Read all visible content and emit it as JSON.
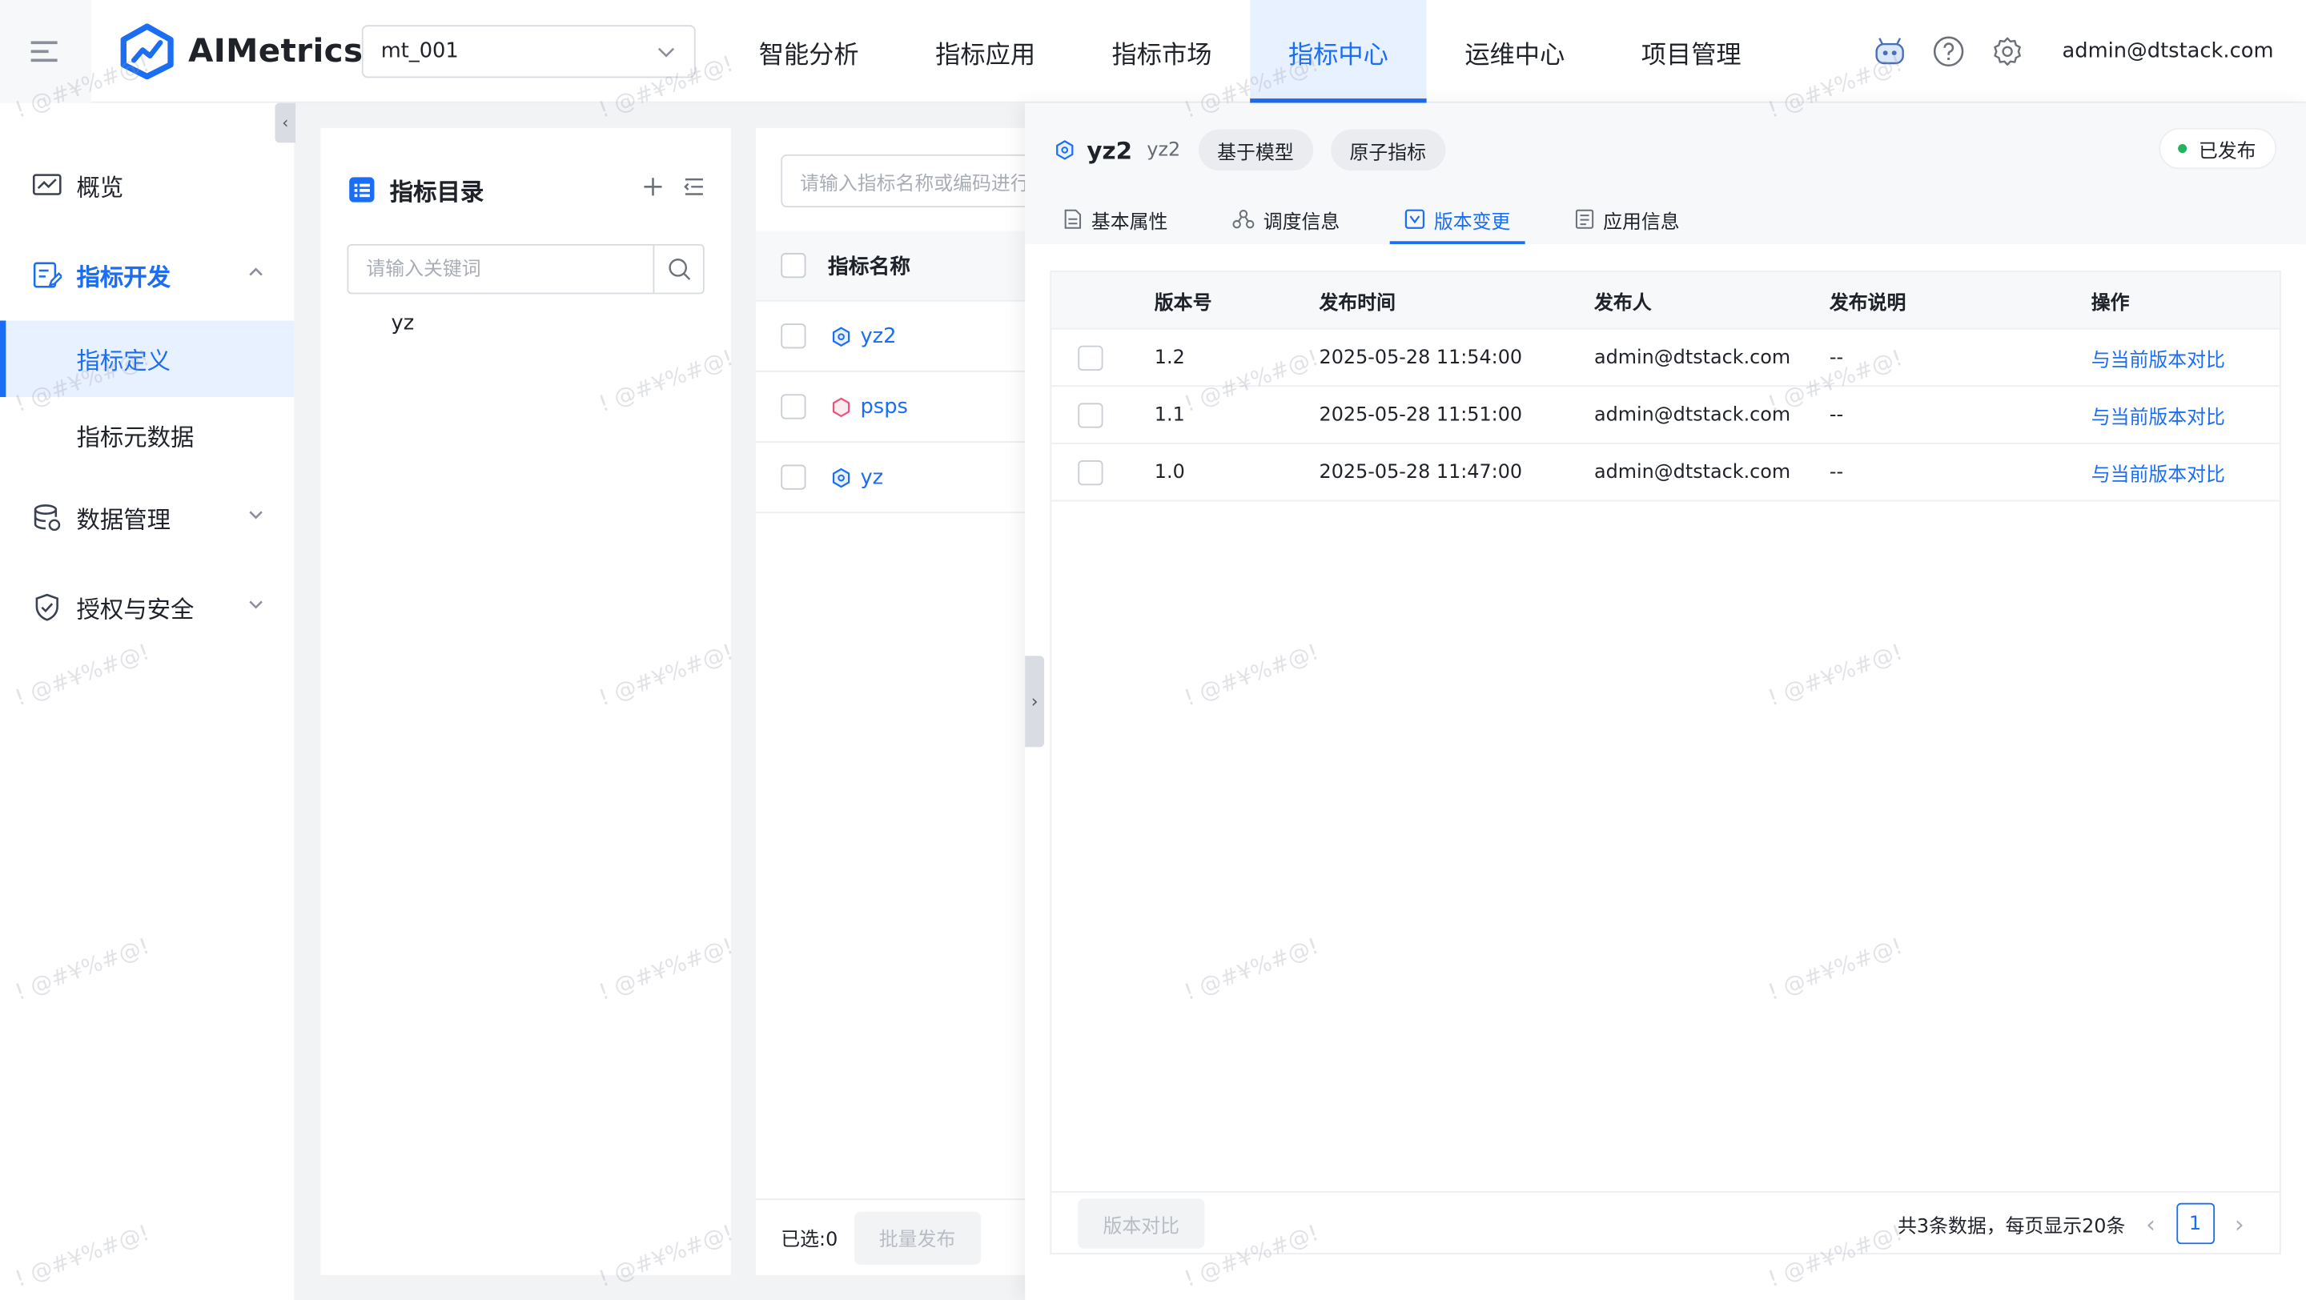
{
  "app": {
    "logo_text": "AIMetrics",
    "brand_color": "#1b6ef3"
  },
  "project_select": {
    "value": "mt_001"
  },
  "nav": {
    "items": [
      {
        "label": "智能分析",
        "active": false
      },
      {
        "label": "指标应用",
        "active": false
      },
      {
        "label": "指标市场",
        "active": false
      },
      {
        "label": "指标中心",
        "active": true
      },
      {
        "label": "运维中心",
        "active": false
      },
      {
        "label": "项目管理",
        "active": false
      }
    ]
  },
  "top_right": {
    "user": "admin@dtstack.com",
    "icons": [
      "robot-icon",
      "help-icon",
      "settings-icon"
    ]
  },
  "sidebar": {
    "items": [
      {
        "label": "概览",
        "icon": "overview-icon"
      },
      {
        "label": "指标开发",
        "icon": "metric-dev-icon",
        "expanded": true
      },
      {
        "label": "数据管理",
        "icon": "database-icon"
      },
      {
        "label": "授权与安全",
        "icon": "shield-icon"
      }
    ],
    "sub_items": [
      {
        "label": "指标定义",
        "active": true
      },
      {
        "label": "指标元数据",
        "active": false
      }
    ]
  },
  "directory": {
    "title": "指标目录",
    "search_placeholder": "请输入关键词",
    "tree": [
      "yz"
    ]
  },
  "metric_list": {
    "search_placeholder": "请输入指标名称或编码进行",
    "column_header": "指标名称",
    "rows": [
      {
        "name": "yz2",
        "icon": "model-metric-icon"
      },
      {
        "name": "psps",
        "icon": "atomic-metric-icon"
      },
      {
        "name": "yz",
        "icon": "model-metric-icon"
      }
    ],
    "selected_label": "已选:0",
    "batch_publish_label": "批量发布"
  },
  "drawer": {
    "name": "yz2",
    "code": "yz2",
    "tags": [
      "基于模型",
      "原子指标"
    ],
    "status": "已发布",
    "tabs": [
      {
        "label": "基本属性",
        "icon": "document-icon",
        "active": false
      },
      {
        "label": "调度信息",
        "icon": "schedule-icon",
        "active": false
      },
      {
        "label": "版本变更",
        "icon": "version-icon",
        "active": true
      },
      {
        "label": "应用信息",
        "icon": "app-info-icon",
        "active": false
      }
    ],
    "table": {
      "headers": [
        "版本号",
        "发布时间",
        "发布人",
        "发布说明",
        "操作"
      ],
      "rows": [
        {
          "version": "1.2",
          "time": "2025-05-28 11:54:00",
          "publisher": "admin@dtstack.com",
          "desc": "--",
          "action": "与当前版本对比"
        },
        {
          "version": "1.1",
          "time": "2025-05-28 11:51:00",
          "publisher": "admin@dtstack.com",
          "desc": "--",
          "action": "与当前版本对比"
        },
        {
          "version": "1.0",
          "time": "2025-05-28 11:47:00",
          "publisher": "admin@dtstack.com",
          "desc": "--",
          "action": "与当前版本对比"
        }
      ]
    },
    "compare_button": "版本对比",
    "pagination": {
      "summary": "共3条数据，每页显示20条",
      "page": "1"
    }
  },
  "watermark": {
    "text": "! @#¥%#@!"
  }
}
